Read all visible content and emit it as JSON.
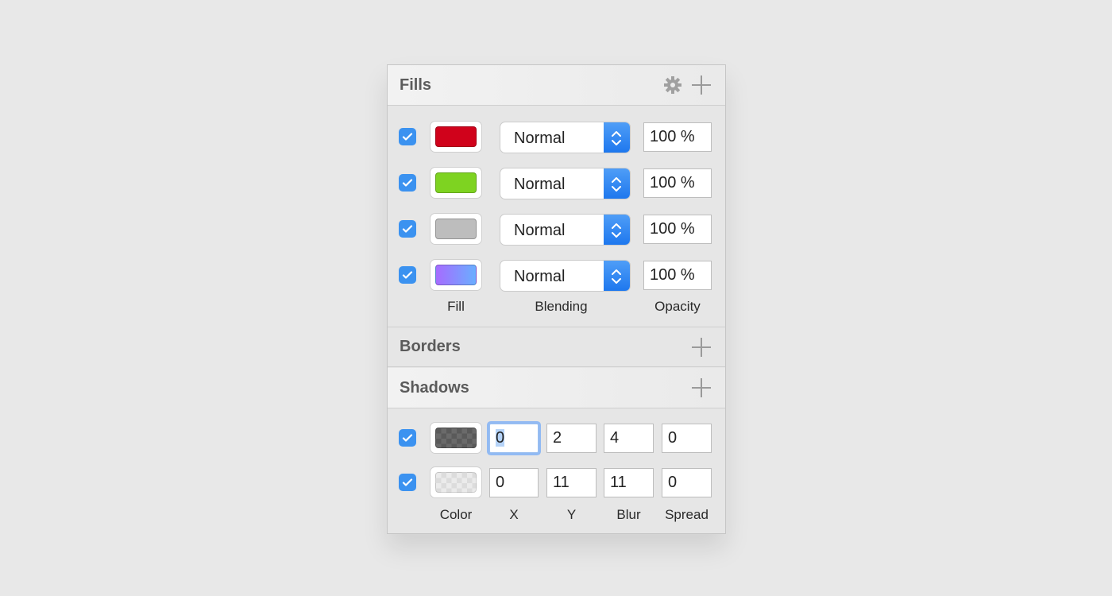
{
  "fills": {
    "title": "Fills",
    "items": [
      {
        "enabled": true,
        "color": "#d0021b",
        "blending": "Normal",
        "opacity": "100 %"
      },
      {
        "enabled": true,
        "color": "#7ed321",
        "blending": "Normal",
        "opacity": "100 %"
      },
      {
        "enabled": true,
        "color": "#bdbdbd",
        "blending": "Normal",
        "opacity": "100 %"
      },
      {
        "enabled": true,
        "color": "linear-gradient(90deg,#a66cff,#6aaeff)",
        "blending": "Normal",
        "opacity": "100 %"
      }
    ],
    "columns": {
      "fill": "Fill",
      "blending": "Blending",
      "opacity": "Opacity"
    }
  },
  "borders": {
    "title": "Borders"
  },
  "shadows": {
    "title": "Shadows",
    "items": [
      {
        "enabled": true,
        "x": "0",
        "y": "2",
        "blur": "4",
        "spread": "0"
      },
      {
        "enabled": true,
        "x": "0",
        "y": "11",
        "blur": "11",
        "spread": "0"
      }
    ],
    "columns": {
      "color": "Color",
      "x": "X",
      "y": "Y",
      "blur": "Blur",
      "spread": "Spread"
    }
  },
  "colors": {
    "accent": "#3b92f0"
  }
}
